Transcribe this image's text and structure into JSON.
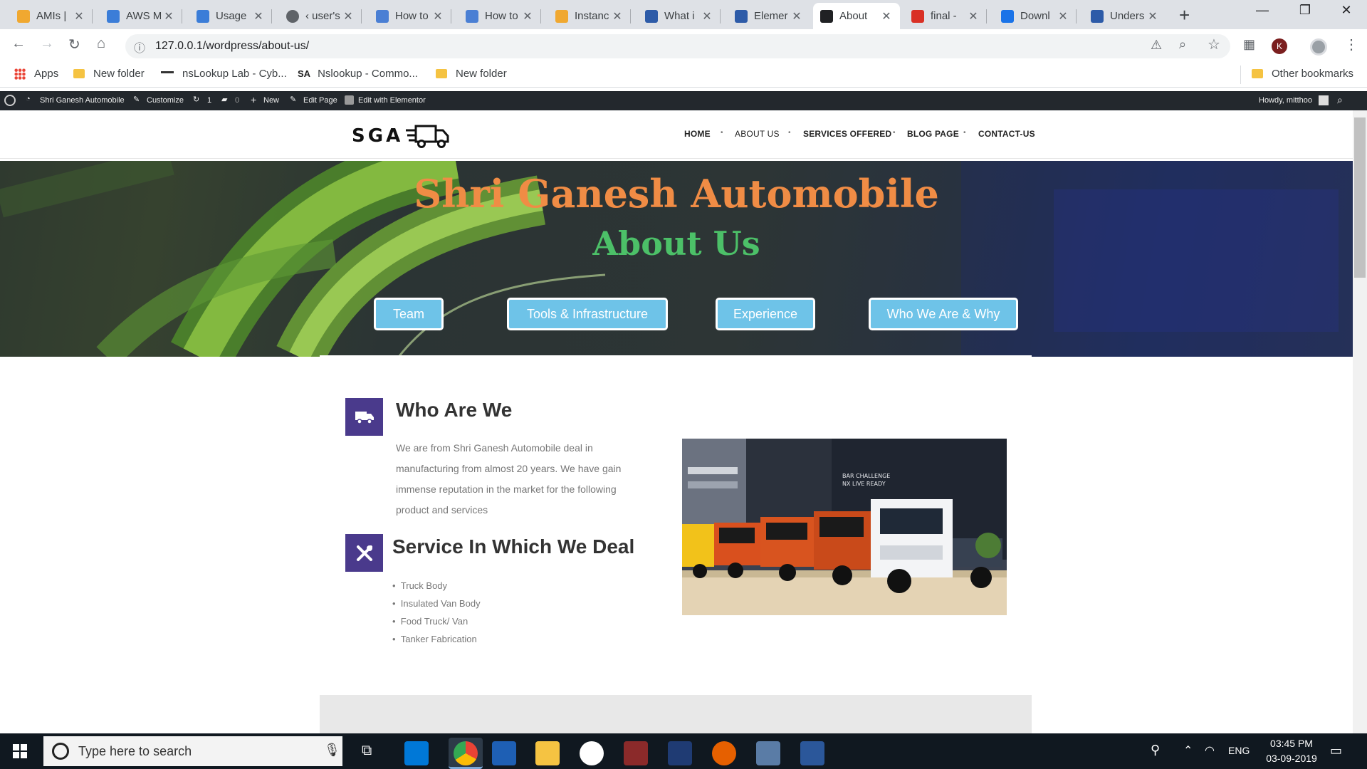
{
  "browser": {
    "tabs": [
      {
        "title": "AMIs |",
        "color": "#f0a830"
      },
      {
        "title": "AWS M",
        "color": "#3b7dd8"
      },
      {
        "title": "Usage",
        "color": "#3b7dd8"
      },
      {
        "title": "‹ user's",
        "color": "#5f6368"
      },
      {
        "title": "How to",
        "color": "#4a7fd4"
      },
      {
        "title": "How to",
        "color": "#4a7fd4"
      },
      {
        "title": "Instanc",
        "color": "#f0a830"
      },
      {
        "title": "What i",
        "color": "#2d5ba8"
      },
      {
        "title": "Elemer",
        "color": "#2d5ba8"
      },
      {
        "title": "About",
        "color": "#202124"
      },
      {
        "title": "final -",
        "color": "#d93025"
      },
      {
        "title": "Downl",
        "color": "#1a73e8"
      },
      {
        "title": "Unders",
        "color": "#2d5ba8"
      }
    ],
    "url": "127.0.0.1/wordpress/about-us/",
    "bookmarks": [
      "Apps",
      "New folder",
      "nsLookup Lab - Cyb...",
      "Nslookup - Commo...",
      "New folder"
    ],
    "other_bookmarks": "Other bookmarks",
    "profile_initial": "K"
  },
  "admin_bar": {
    "site_name": "Shri Ganesh Automobile",
    "customize": "Customize",
    "updates": "1",
    "comments": "0",
    "new": "New",
    "edit_page": "Edit Page",
    "elementor": "Edit with Elementor",
    "howdy": "Howdy, mitthoo"
  },
  "site": {
    "logo": "SGA",
    "nav": [
      "HOME",
      "ABOUT US",
      "SERVICES OFFERED",
      "BLOG PAGE",
      "CONTACT-US"
    ],
    "hero_title": "Shri Ganesh Automobile",
    "hero_subtitle": "About Us",
    "hero_buttons": [
      "Team",
      "Tools & Infrastructure",
      "Experience",
      "Who We Are & Why"
    ],
    "section1": {
      "heading": "Who Are We",
      "lines": [
        "We are from Shri Ganesh Automobile deal in",
        "manufacturing from almost 20 years. We have gain",
        "immense reputation in the market for the following",
        "product and services"
      ]
    },
    "section2": {
      "heading": "Service In Which We Deal",
      "items": [
        "Truck Body",
        "Insulated Van Body",
        "Food Truck/ Van",
        "Tanker Fabrication"
      ]
    },
    "truck_banner": "BAR CHALLENGE\nNX LIVE READY"
  },
  "taskbar": {
    "search_placeholder": "Type here to search",
    "lang": "ENG",
    "time": "03:45 PM",
    "date": "03-09-2019"
  },
  "colors": {
    "hero_title": "#f08c45",
    "hero_subtitle": "#4cc068",
    "hero_button": "#6ec3e8",
    "icon_box": "#4a3a8c",
    "admin_bar": "#23282d"
  }
}
